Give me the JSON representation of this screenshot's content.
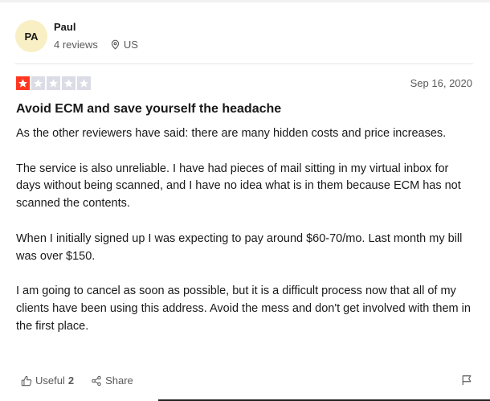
{
  "reviewer": {
    "initials": "PA",
    "name": "Paul",
    "reviews": "4 reviews",
    "location": "US"
  },
  "review": {
    "rating": 1,
    "max_rating": 5,
    "date": "Sep 16, 2020",
    "title": "Avoid ECM and save yourself the headache",
    "paragraphs": [
      "As the other reviewers have said: there are many hidden costs and price increases.",
      "The service is also unreliable. I have had pieces of mail sitting in my virtual inbox for days without being scanned, and I have no idea what is in them because ECM has not scanned the contents.",
      "When I initially signed up I was expecting to pay around $60-70/mo. Last month my bill was over $150.",
      "I am going to cancel as soon as possible, but it is a difficult process now that all of my clients have been using this address. Avoid the mess and don't get involved with them in the first place."
    ]
  },
  "actions": {
    "useful_label": "Useful",
    "useful_count": "2",
    "share_label": "Share"
  },
  "colors": {
    "star_filled": "#ff3722",
    "star_empty": "#dcdce6",
    "avatar_bg": "#f9efc4"
  },
  "icons": [
    "location-pin-icon",
    "star-icon",
    "thumbs-up-icon",
    "share-icon",
    "flag-icon"
  ]
}
